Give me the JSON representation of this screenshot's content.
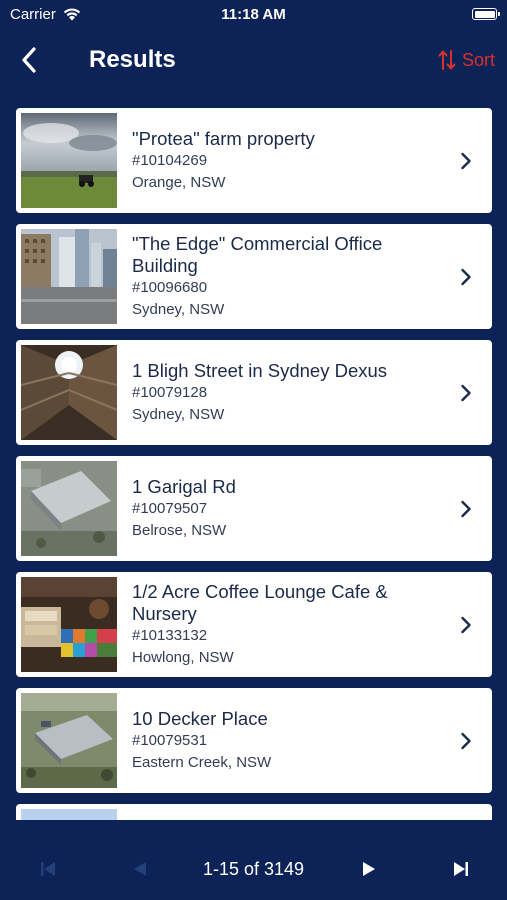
{
  "status_bar": {
    "carrier": "Carrier",
    "time": "11:18 AM"
  },
  "nav": {
    "title": "Results",
    "sort_label": "Sort",
    "back_icon": "chevron-left-icon",
    "sort_icon": "sort-arrows-icon"
  },
  "colors": {
    "background": "#0d2358",
    "accent": "#d8302b",
    "card": "#ffffff",
    "text": "#1b2a48"
  },
  "results": [
    {
      "title": "\"Protea\" farm property",
      "id": "#10104269",
      "location": "Orange, NSW",
      "image": "farm-field"
    },
    {
      "title": "\"The Edge\" Commercial Office Building",
      "id": "#10096680",
      "location": "Sydney, NSW",
      "image": "office-towers"
    },
    {
      "title": "1 Bligh Street in Sydney Dexus",
      "id": "#10079128",
      "location": "Sydney, NSW",
      "image": "atrium"
    },
    {
      "title": "1 Garigal Rd",
      "id": "#10079507",
      "location": "Belrose, NSW",
      "image": "aerial-warehouse"
    },
    {
      "title": "1/2 Acre Coffee Lounge Cafe & Nursery",
      "id": "#10133132",
      "location": "Howlong, NSW",
      "image": "cafe-interior"
    },
    {
      "title": "10 Decker Place",
      "id": "#10079531",
      "location": "Eastern Creek, NSW",
      "image": "aerial-industrial"
    }
  ],
  "pager": {
    "label": "1-15 of 3149"
  }
}
